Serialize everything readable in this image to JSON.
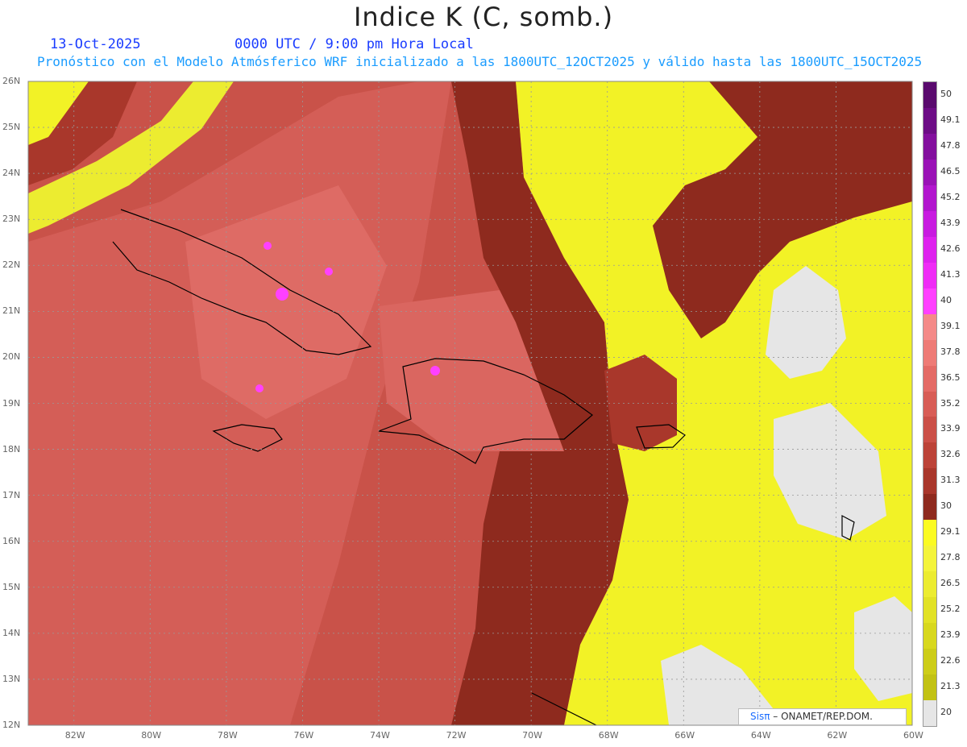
{
  "header": {
    "title": "Indice K (C, somb.)",
    "date": "13-Oct-2025",
    "time": "0000 UTC / 9:00 pm Hora Local",
    "description": "Pronóstico con el Modelo Atmósferico WRF inicializado a las 1800UTC_12OCT2025 y válido hasta las  1800UTC_15OCT2025"
  },
  "map": {
    "lat_labels": [
      "26N",
      "25N",
      "24N",
      "23N",
      "22N",
      "21N",
      "20N",
      "19N",
      "18N",
      "17N",
      "16N",
      "15N",
      "14N",
      "13N",
      "12N"
    ],
    "lon_labels": [
      "82W",
      "80W",
      "78W",
      "76W",
      "74W",
      "72W",
      "70W",
      "68W",
      "66W",
      "64W",
      "62W",
      "60W"
    ],
    "lat_range": [
      12,
      26
    ],
    "lon_range": [
      -83.2,
      -60
    ],
    "grid": true
  },
  "legend": {
    "labels": [
      "50",
      "49.1",
      "47.8",
      "46.5",
      "45.2",
      "43.9",
      "42.6",
      "41.3",
      "40",
      "39.1",
      "37.8",
      "36.5",
      "35.2",
      "33.9",
      "32.6",
      "31.3",
      "30",
      "29.1",
      "27.8",
      "26.5",
      "25.2",
      "23.9",
      "22.6",
      "21.3",
      "20"
    ],
    "colors": [
      "#5a0a6e",
      "#6d0c86",
      "#830f9e",
      "#9a12b6",
      "#b216ce",
      "#c81be0",
      "#de22ee",
      "#ef2cf6",
      "#ff40ff",
      "#f48a88",
      "#ee7b76",
      "#e46b66",
      "#d85d56",
      "#cb5048",
      "#bc4338",
      "#a9372b",
      "#8e2a1e",
      "#fbfb22",
      "#f4f43a",
      "#ecec30",
      "#e2e226",
      "#d8d81e",
      "#cdcd18",
      "#c2c214",
      "#e6e6e6"
    ]
  },
  "credit": {
    "logo": "Sisπ",
    "text": " – ONAMET/REP.DOM."
  }
}
